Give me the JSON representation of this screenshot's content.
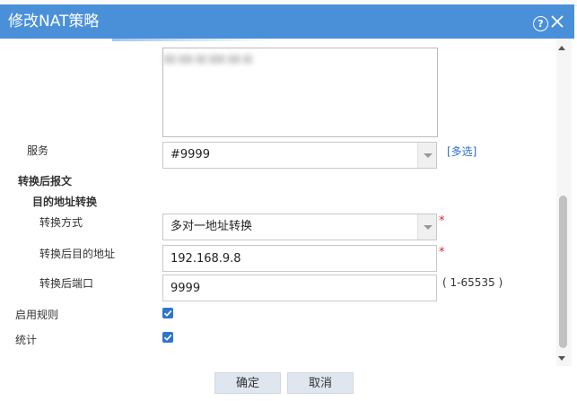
{
  "dialog": {
    "title": "修改NAT策略",
    "help_glyph": "?"
  },
  "form": {
    "service": {
      "label": "服务",
      "value": "#9999",
      "multi_select_link": "[多选]"
    },
    "section_translated_packet": "转换后报文",
    "subsection_dest_translation": "目的地址转换",
    "translation_mode": {
      "label": "转换方式",
      "value": "多对一地址转换",
      "required": "*"
    },
    "translated_dest_address": {
      "label": "转换后目的地址",
      "value": "192.168.9.8",
      "required": "*"
    },
    "translated_port": {
      "label": "转换后端口",
      "value": "9999",
      "hint": "( 1-65535 )"
    },
    "enable_rule": {
      "label": "启用规则",
      "checked": true
    },
    "statistics": {
      "label": "统计",
      "checked": true
    }
  },
  "footer": {
    "ok_label": "确定",
    "cancel_label": "取消"
  },
  "colors": {
    "title_bar": "#4a90d9",
    "checkbox": "#2f74cf",
    "link": "#2a6fc9",
    "required_star": "#e02020"
  }
}
